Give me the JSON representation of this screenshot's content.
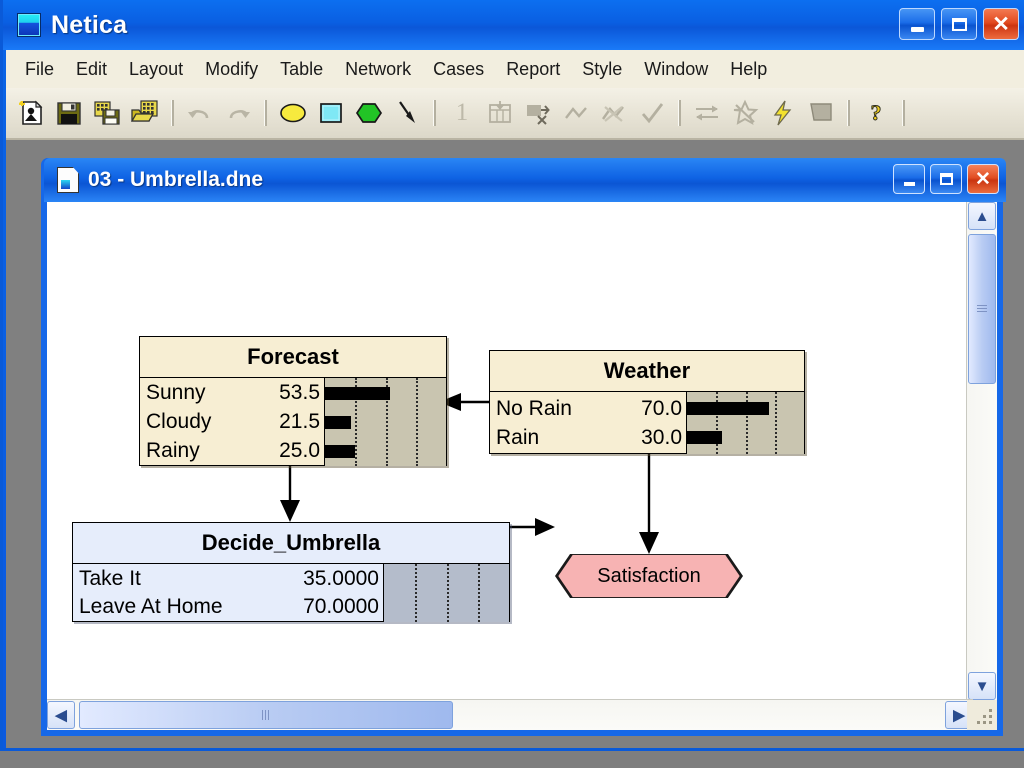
{
  "app": {
    "title": "Netica",
    "icon": "netica-app-icon",
    "window_buttons": [
      {
        "name": "minimize-button",
        "glyph": "_"
      },
      {
        "name": "maximize-button",
        "glyph": "□"
      },
      {
        "name": "close-button",
        "glyph": "✕"
      }
    ]
  },
  "menu": {
    "items": [
      {
        "label": "File"
      },
      {
        "label": "Edit"
      },
      {
        "label": "Layout"
      },
      {
        "label": "Modify"
      },
      {
        "label": "Table"
      },
      {
        "label": "Network"
      },
      {
        "label": "Cases"
      },
      {
        "label": "Report"
      },
      {
        "label": "Style"
      },
      {
        "label": "Window"
      },
      {
        "label": "Help"
      }
    ]
  },
  "toolbar": {
    "buttons": [
      {
        "name": "new-network-icon",
        "label": "New Network",
        "enabled": true
      },
      {
        "name": "save-icon",
        "label": "Save",
        "enabled": true
      },
      {
        "name": "save-all-icon",
        "label": "Save All",
        "enabled": true
      },
      {
        "name": "open-icon",
        "label": "Open",
        "enabled": true
      },
      {
        "name": "undo-icon",
        "label": "Undo",
        "enabled": false
      },
      {
        "name": "redo-icon",
        "label": "Redo",
        "enabled": false
      },
      {
        "name": "nature-node-icon",
        "label": "Nature Node",
        "enabled": true
      },
      {
        "name": "decision-node-icon",
        "label": "Decision Node",
        "enabled": true
      },
      {
        "name": "utility-node-icon",
        "label": "Utility Node",
        "enabled": true
      },
      {
        "name": "link-tool-icon",
        "label": "Add Link",
        "enabled": true
      },
      {
        "name": "one-level-icon",
        "label": "1",
        "enabled": false
      },
      {
        "name": "compile-icon",
        "label": "Compile",
        "enabled": false
      },
      {
        "name": "enter-findings-icon",
        "label": "Enter Findings",
        "enabled": false
      },
      {
        "name": "retract-icon",
        "label": "Retract Finding",
        "enabled": false
      },
      {
        "name": "retract-all-icon",
        "label": "Retract All Findings",
        "enabled": false
      },
      {
        "name": "check-icon",
        "label": "Accept",
        "enabled": false
      },
      {
        "name": "swap-icon",
        "label": "Reverse Link",
        "enabled": false
      },
      {
        "name": "absorb-icon",
        "label": "Absorb Node",
        "enabled": false
      },
      {
        "name": "lightning-icon",
        "label": "Auto Update",
        "enabled": true
      },
      {
        "name": "shade-icon",
        "label": "Shading",
        "enabled": false
      },
      {
        "name": "help-icon",
        "label": "Help",
        "enabled": true
      }
    ],
    "level_indicator": "1"
  },
  "document": {
    "title": "03 - Umbrella.dne",
    "icon": "document-icon",
    "window_buttons": [
      {
        "name": "doc-minimize-button",
        "glyph": "_"
      },
      {
        "name": "doc-maximize-button",
        "glyph": "□"
      },
      {
        "name": "doc-close-button",
        "glyph": "✕"
      }
    ]
  },
  "colors": {
    "chance_node_bg": "#f7eed3",
    "chance_bar_bg": "#c9c5b0",
    "decision_node_bg": "#e6edfb",
    "decision_bar_bg": "#b4bccb",
    "utility_node_bg": "#f7b3b3",
    "canvas_bg": "#ffffff",
    "titlebar_blue": "#0a5fe2",
    "menubar_bg": "#f2eedf"
  },
  "network": {
    "nodes": [
      {
        "id": "forecast",
        "name": "Forecast",
        "type": "chance",
        "states": [
          {
            "label": "Sunny",
            "value": "53.5",
            "belief": 53.5
          },
          {
            "label": "Cloudy",
            "value": "21.5",
            "belief": 21.5
          },
          {
            "label": "Rainy",
            "value": "25.0",
            "belief": 25.0
          }
        ]
      },
      {
        "id": "weather",
        "name": "Weather",
        "type": "chance",
        "states": [
          {
            "label": "No Rain",
            "value": "70.0",
            "belief": 70.0
          },
          {
            "label": "Rain",
            "value": "30.0",
            "belief": 30.0
          }
        ]
      },
      {
        "id": "decide_umbrella",
        "name": "Decide_Umbrella",
        "type": "decision",
        "states": [
          {
            "label": "Take It",
            "value": "35.0000",
            "belief": 0
          },
          {
            "label": "Leave At Home",
            "value": "70.0000",
            "belief": 0
          }
        ]
      },
      {
        "id": "satisfaction",
        "name": "Satisfaction",
        "type": "utility",
        "states": []
      }
    ],
    "links": [
      {
        "from": "weather",
        "to": "forecast"
      },
      {
        "from": "forecast",
        "to": "decide_umbrella"
      },
      {
        "from": "weather",
        "to": "satisfaction"
      },
      {
        "from": "decide_umbrella",
        "to": "satisfaction"
      }
    ]
  },
  "scrollbars": {
    "vertical": {
      "up": "▲",
      "down": "▼"
    },
    "horizontal": {
      "left": "◀",
      "right": "▶"
    }
  }
}
